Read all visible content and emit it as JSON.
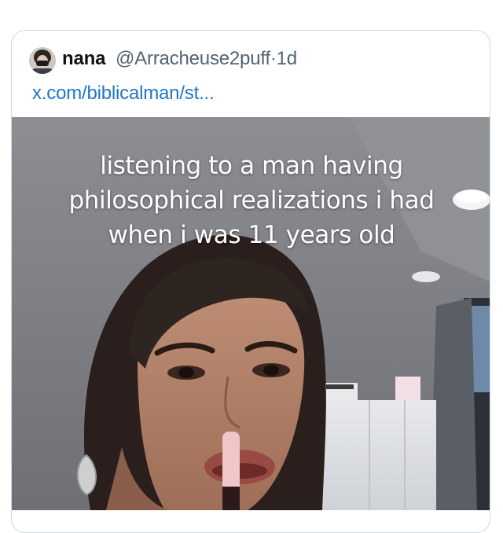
{
  "tweet": {
    "author_name": "nana",
    "handle": "@Arracheuse2puff",
    "separator": "·",
    "time": "1d",
    "link_text": "x.com/biblicalman/st..."
  },
  "video": {
    "caption_lines": [
      "listening to a man having",
      "philosophical realizations i had",
      "when i was 11 years old"
    ]
  },
  "colors": {
    "link": "#1d77c8",
    "handle": "#536471",
    "name": "#0f1419",
    "card_border": "#cfd9de"
  }
}
